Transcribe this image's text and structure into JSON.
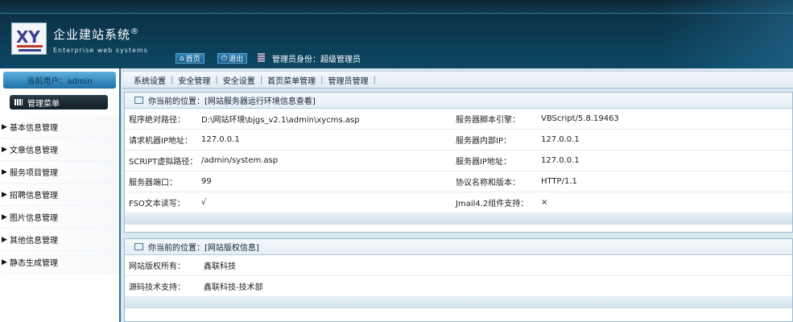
{
  "app": {
    "title": "企业建站系统",
    "registered": "®",
    "subtitle": "Enterprise web systems",
    "logo_text": "XY"
  },
  "header": {
    "home_label": "首页",
    "logout_label": "退出",
    "admin_role": "管理员身份：超级管理员"
  },
  "sidebar": {
    "current_user": "当前用户：admin",
    "menu_title": "管理菜单",
    "items": [
      {
        "label": "基本信息管理"
      },
      {
        "label": "文章信息管理"
      },
      {
        "label": "服务项目管理"
      },
      {
        "label": "招聘信息管理"
      },
      {
        "label": "图片信息管理"
      },
      {
        "label": "其他信息管理"
      },
      {
        "label": "静态生成管理"
      }
    ]
  },
  "tabs": [
    "系统设置",
    "安全管理",
    "安全设置",
    "首页菜单管理",
    "管理员管理"
  ],
  "server_panel": {
    "breadcrumb": "你当前的位置：[网站服务器运行环境信息查看]",
    "rows": [
      {
        "label1": "程序绝对路径：",
        "value1": "D:\\网站环境\\bjgs_v2.1\\admin\\xycms.asp",
        "label2": "服务器脚本引擎：",
        "value2": "VBScript/5.8.19463"
      },
      {
        "label1": "请求机器IP地址：",
        "value1": "127.0.0.1",
        "label2": "服务器内部IP：",
        "value2": "127.0.0.1"
      },
      {
        "label1": "SCRIPT虚拟路径：",
        "value1": "/admin/system.asp",
        "label2": "服务器IP地址：",
        "value2": "127.0.0.1"
      },
      {
        "label1": "服务器端口：",
        "value1": "99",
        "label2": "协议名称和版本：",
        "value2": "HTTP/1.1"
      },
      {
        "label1": "FSO文本读写：",
        "value1": "√",
        "label2": "Jmail4.2组件支持：",
        "value2": "×"
      }
    ]
  },
  "copyright_panel": {
    "breadcrumb": "你当前的位置：[网站版权信息]",
    "rows": [
      {
        "label": "网站版权所有：",
        "value": "鑫联科技"
      },
      {
        "label": "源码技术支持：",
        "value": "鑫联科技-技术部"
      }
    ]
  },
  "colors": {
    "header_bg": "#0d3d56",
    "accent": "#2b6e96"
  }
}
